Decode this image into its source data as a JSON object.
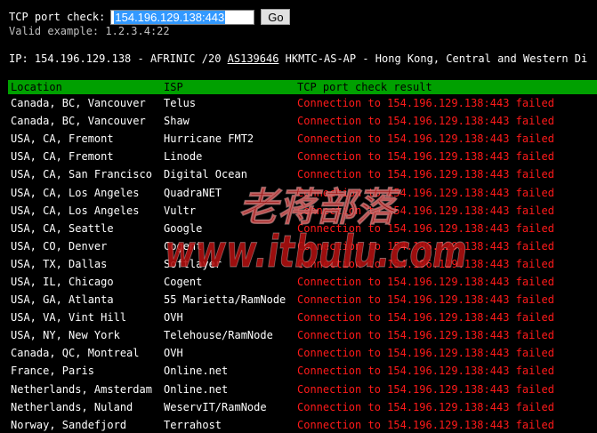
{
  "form": {
    "label": "TCP port check:",
    "input_value": "154.196.129.138:443",
    "go_label": "Go",
    "example_text": "Valid example: 1.2.3.4:22"
  },
  "ip_info": {
    "prefix": "IP: 154.196.129.138 - AFRINIC /20 ",
    "asn": "AS139646",
    "suffix": " HKMTC-AS-AP - Hong Kong, Central and Western Di"
  },
  "table": {
    "headers": [
      "Location",
      "ISP",
      "TCP port check result"
    ],
    "rows": [
      [
        "Canada, BC, Vancouver",
        "Telus",
        "Connection to 154.196.129.138:443 failed"
      ],
      [
        "Canada, BC, Vancouver",
        "Shaw",
        "Connection to 154.196.129.138:443 failed"
      ],
      [
        "USA, CA, Fremont",
        "Hurricane FMT2",
        "Connection to 154.196.129.138:443 failed"
      ],
      [
        "USA, CA, Fremont",
        "Linode",
        "Connection to 154.196.129.138:443 failed"
      ],
      [
        "USA, CA, San Francisco",
        "Digital Ocean",
        "Connection to 154.196.129.138:443 failed"
      ],
      [
        "USA, CA, Los Angeles",
        "QuadraNET",
        "Connection to 154.196.129.138:443 failed"
      ],
      [
        "USA, CA, Los Angeles",
        "Vultr",
        "Connection to 154.196.129.138:443 failed"
      ],
      [
        "USA, CA, Seattle",
        "Google",
        "Connection to 154.196.129.138:443 failed"
      ],
      [
        "USA, CO, Denver",
        "Cogent",
        "Connection to 154.196.129.138:443 failed"
      ],
      [
        "USA, TX, Dallas",
        "Softlayer",
        "Connection to 154.196.129.138:443 failed"
      ],
      [
        "USA, IL, Chicago",
        "Cogent",
        "Connection to 154.196.129.138:443 failed"
      ],
      [
        "USA, GA, Atlanta",
        "55 Marietta/RamNode",
        "Connection to 154.196.129.138:443 failed"
      ],
      [
        "USA, VA, Vint Hill",
        "OVH",
        "Connection to 154.196.129.138:443 failed"
      ],
      [
        "USA, NY, New York",
        "Telehouse/RamNode",
        "Connection to 154.196.129.138:443 failed"
      ],
      [
        "Canada, QC, Montreal",
        "OVH",
        "Connection to 154.196.129.138:443 failed"
      ],
      [
        "France, Paris",
        "Online.net",
        "Connection to 154.196.129.138:443 failed"
      ],
      [
        "Netherlands, Amsterdam",
        "Online.net",
        "Connection to 154.196.129.138:443 failed"
      ],
      [
        "Netherlands, Nuland",
        "WeservIT/RamNode",
        "Connection to 154.196.129.138:443 failed"
      ],
      [
        "Norway, Sandefjord",
        "Terrahost",
        "Connection to 154.196.129.138:443 failed"
      ]
    ]
  },
  "watermark": {
    "line1": "老蒋部落",
    "line2": "www.itbulu.com"
  },
  "colors": {
    "header_bg": "#00a000",
    "fail_text": "#ff1a1a",
    "watermark": "#b01010"
  }
}
